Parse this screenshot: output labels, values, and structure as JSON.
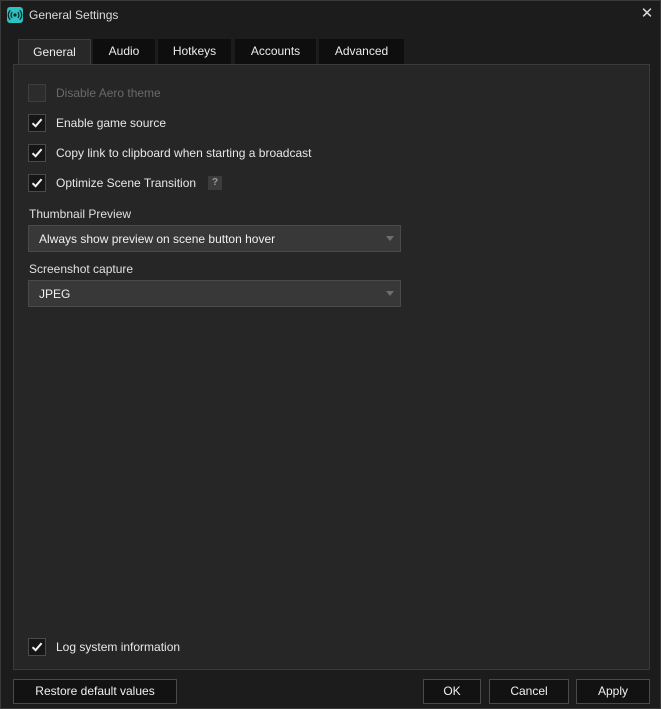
{
  "window": {
    "title": "General Settings",
    "close_glyph": "✕"
  },
  "icons": {
    "app": "broadcast-icon",
    "close": "close-icon",
    "check": "checkmark-icon",
    "help": "help-icon",
    "dropdown": "chevron-down-icon"
  },
  "colors": {
    "accent": "#2fc0c0",
    "background": "#1c1c1c",
    "panel": "#262626"
  },
  "tabs": [
    {
      "label": "General",
      "active": true
    },
    {
      "label": "Audio",
      "active": false
    },
    {
      "label": "Hotkeys",
      "active": false
    },
    {
      "label": "Accounts",
      "active": false
    },
    {
      "label": "Advanced",
      "active": false
    }
  ],
  "settings": {
    "disable_aero": {
      "label": "Disable Aero theme",
      "checked": false,
      "disabled": true
    },
    "enable_game_source": {
      "label": "Enable game source",
      "checked": true
    },
    "copy_link": {
      "label": "Copy link to clipboard when starting a broadcast",
      "checked": true
    },
    "optimize_scene": {
      "label": "Optimize Scene Transition",
      "checked": true,
      "help": "?"
    },
    "thumbnail": {
      "label": "Thumbnail Preview",
      "value": "Always show preview on scene button hover"
    },
    "screenshot": {
      "label": "Screenshot capture",
      "value": "JPEG"
    },
    "log_system": {
      "label": "Log system information",
      "checked": true
    }
  },
  "buttons": {
    "restore": "Restore default values",
    "ok": "OK",
    "cancel": "Cancel",
    "apply": "Apply"
  }
}
